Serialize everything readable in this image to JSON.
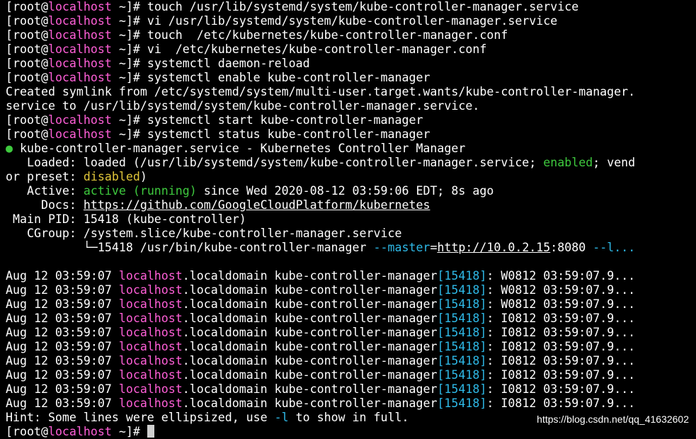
{
  "prompt": {
    "open": "[root@",
    "host": "localhost",
    "close": " ~]# "
  },
  "commands": {
    "c1": "touch /usr/lib/systemd/system/kube-controller-manager.service",
    "c2": "vi /usr/lib/systemd/system/kube-controller-manager.service",
    "c3": "touch  /etc/kubernetes/kube-controller-manager.conf",
    "c4": "vi  /etc/kubernetes/kube-controller-manager.conf",
    "c5": "systemctl daemon-reload",
    "c6": "systemctl enable kube-controller-manager",
    "c7": "systemctl start kube-controller-manager",
    "c8": "systemctl status kube-controller-manager"
  },
  "output": {
    "symlink1": "Created symlink from /etc/systemd/system/multi-user.target.wants/kube-controller-manager.",
    "symlink2": "service to /usr/lib/systemd/system/kube-controller-manager.service."
  },
  "status": {
    "bullet": "●",
    "header": " kube-controller-manager.service - Kubernetes Controller Manager",
    "loaded_label": "   Loaded: ",
    "loaded_pre": "loaded (/usr/lib/systemd/system/kube-controller-manager.service; ",
    "loaded_enabled": "enabled",
    "loaded_post": "; vend",
    "preset_pre": "or preset: ",
    "preset_disabled": "disabled",
    "preset_post": ")",
    "active_label": "   Active: ",
    "active_value": "active (running)",
    "active_post": " since Wed 2020-08-12 03:59:06 EDT; 8s ago",
    "docs_label": "     Docs: ",
    "docs_url": "https://github.com/GoogleCloudPlatform/kubernetes",
    "pid_label": " Main PID: ",
    "pid_value": "15418 (kube-controller)",
    "cgroup_label": "   CGroup: ",
    "cgroup_value": "/system.slice/kube-controller-manager.service",
    "tree_indent": "           └─15418 /usr/bin/kube-controller-manager ",
    "tree_flag": "--master",
    "tree_eq": "=",
    "tree_url": "http://10.0.2.15",
    "tree_port": ":8080 ",
    "tree_tail": "--l..."
  },
  "log": {
    "ts": "Aug 12 03:59:07 ",
    "host": "localhost",
    "domain": ".localdomain kube-controller-manager",
    "pid": "[15418]",
    "colon": ": ",
    "entries": [
      "W0812 03:59:07.9...",
      "W0812 03:59:07.9...",
      "W0812 03:59:07.9...",
      "I0812 03:59:07.9...",
      "I0812 03:59:07.9...",
      "I0812 03:59:07.9...",
      "I0812 03:59:07.9...",
      "I0812 03:59:07.9...",
      "I0812 03:59:07.9...",
      "I0812 03:59:07.9..."
    ]
  },
  "hint": {
    "pre": "Hint: Some lines were ellipsized, use ",
    "flag": "-l",
    "post": " to show in full."
  },
  "watermark": "https://blog.csdn.net/qq_41632602"
}
